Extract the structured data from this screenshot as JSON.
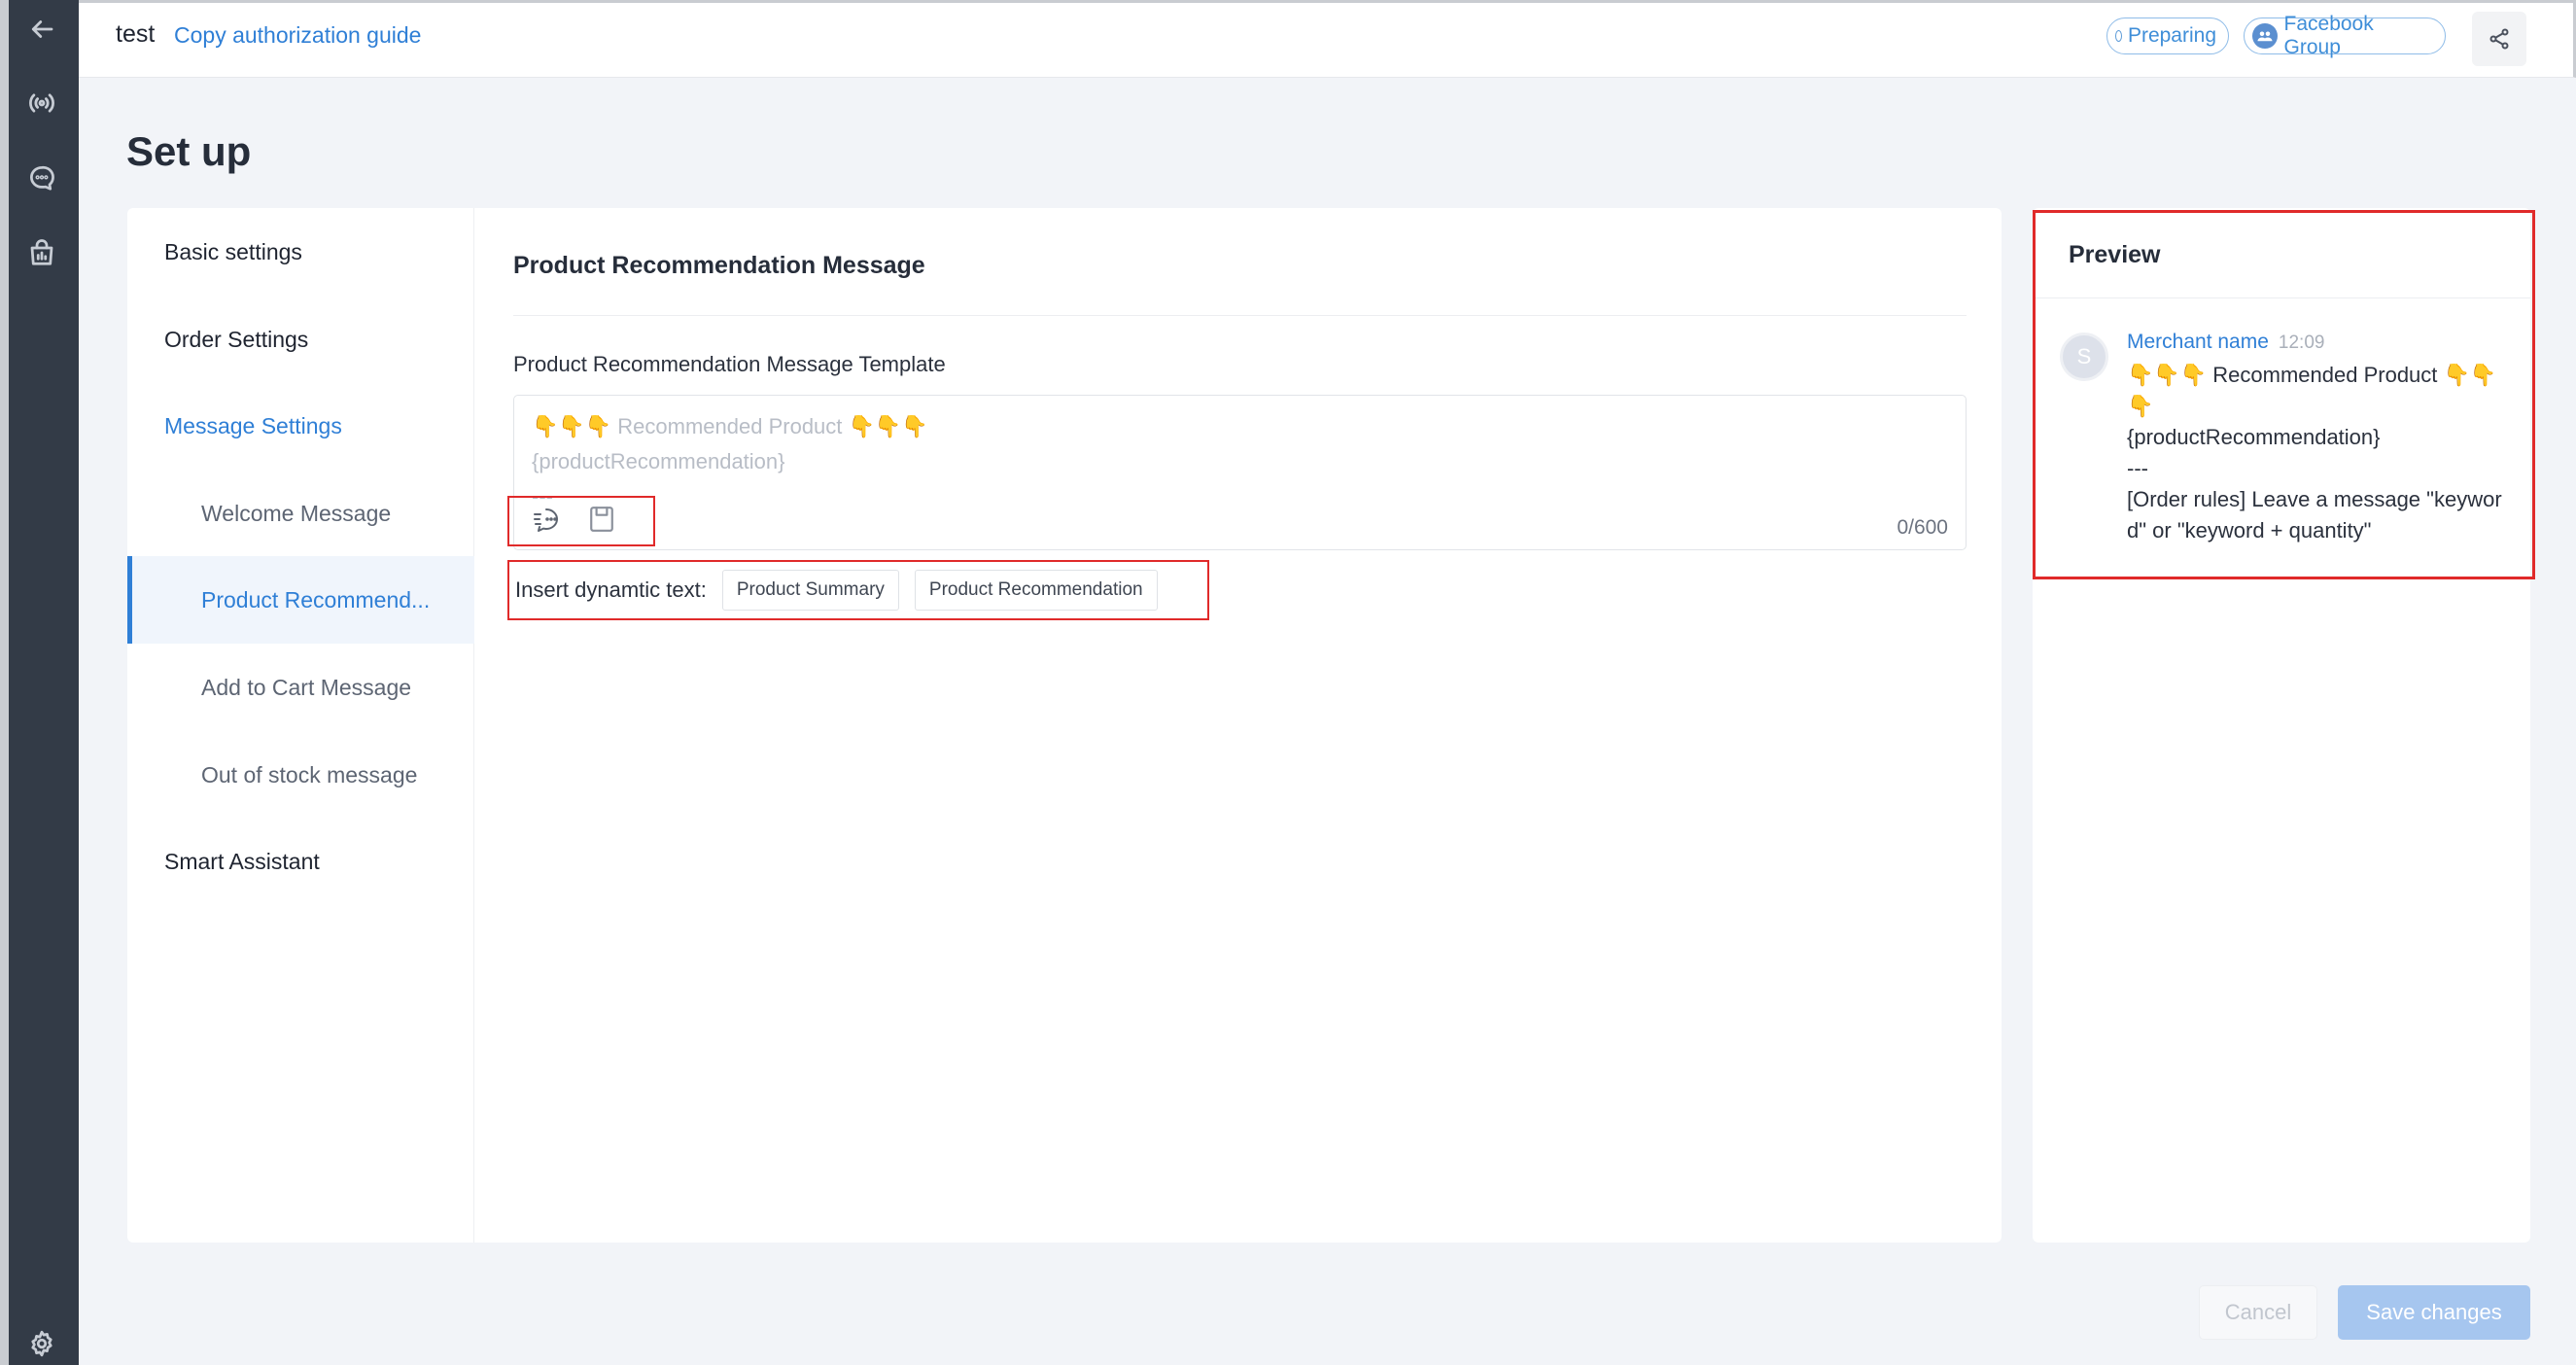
{
  "header": {
    "title": "test",
    "guide_link": "Copy authorization guide",
    "status": "Preparing",
    "channel": "Facebook Group"
  },
  "page_title": "Set up",
  "menu": {
    "basic": "Basic settings",
    "order": "Order Settings",
    "message": "Message Settings",
    "welcome": "Welcome Message",
    "product": "Product Recommend...",
    "cart": "Add to Cart Message",
    "stock": "Out of stock message",
    "assistant": "Smart Assistant"
  },
  "content": {
    "heading": "Product Recommendation Message",
    "template_label": "Product Recommendation Message Template",
    "editor_text": "👇👇👇 Recommended Product 👇👇👇\n{productRecommendation}\n---",
    "char_count": "0/600",
    "insert_label": "Insert dynamtic text:",
    "chips": [
      "Product Summary",
      "Product Recommendation"
    ]
  },
  "preview": {
    "title": "Preview",
    "avatar_letter": "S",
    "merchant": "Merchant name",
    "time": "12:09",
    "message": "👇👇👇 Recommended Product 👇👇👇\n{productRecommendation}\n---\n[Order rules] Leave a message \"keyword\" or \"keyword + quantity\""
  },
  "footer": {
    "cancel": "Cancel",
    "save": "Save changes"
  },
  "icons": [
    "back-arrow-icon",
    "broadcast-icon",
    "chat-icon",
    "shop-icon",
    "settings-gear-icon",
    "group-icon",
    "share-icon",
    "quick-reply-icon",
    "save-template-icon"
  ],
  "colors": {
    "accent": "#2f7fd6",
    "sidebar": "#333b47",
    "highlight": "#e02a2a"
  }
}
